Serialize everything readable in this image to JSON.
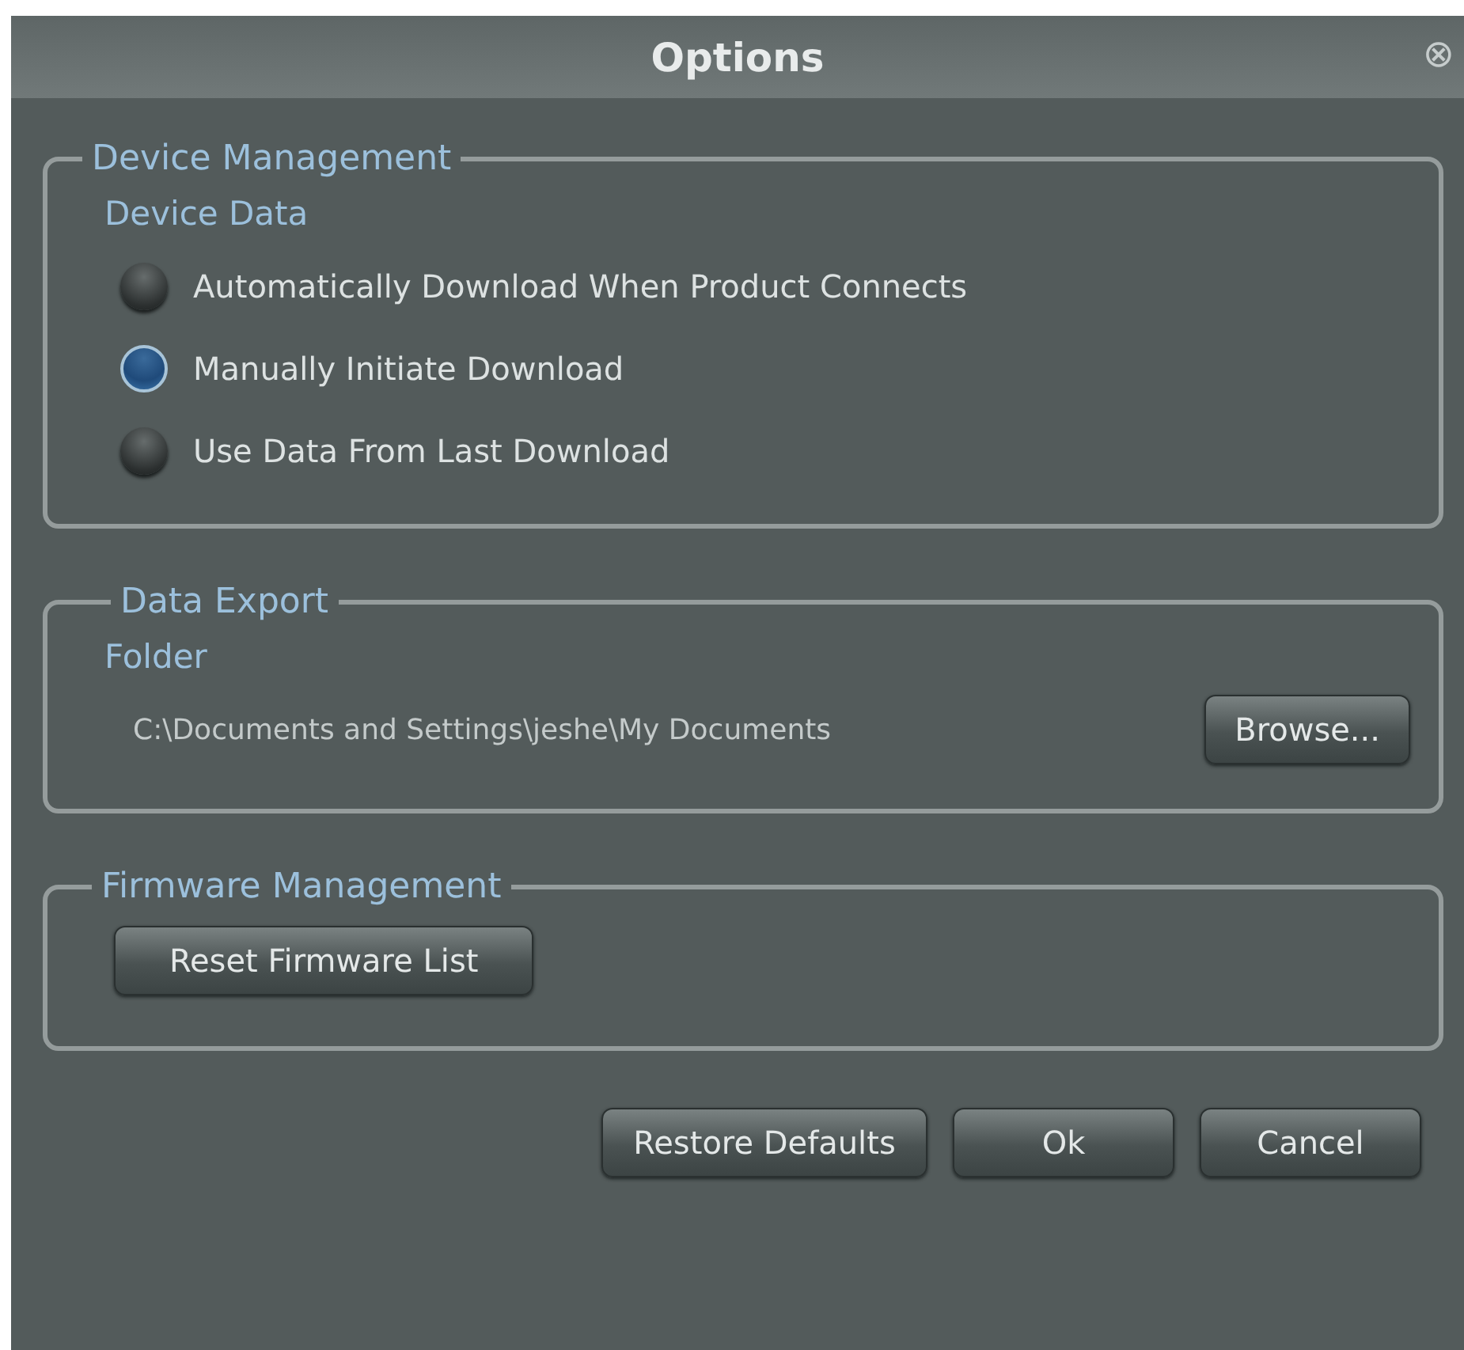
{
  "window": {
    "title": "Options",
    "close_icon": "⊗"
  },
  "sections": [
    {
      "kind": "radios",
      "title": "Device Management",
      "subtitle": "Device Data",
      "options": [
        {
          "label": "Automatically Download When Product Connects",
          "selected": false
        },
        {
          "label": "Manually Initiate Download",
          "selected": true
        },
        {
          "label": "Use Data From Last Download",
          "selected": false
        }
      ]
    },
    {
      "kind": "folder",
      "title": "Data Export",
      "subtitle": "Folder",
      "path": "C:\\Documents and Settings\\jeshe\\My Documents",
      "button": "Browse..."
    },
    {
      "kind": "button",
      "title": "Firmware Management",
      "button": "Reset Firmware List"
    }
  ],
  "buttons": [
    "Restore Defaults",
    "Ok",
    "Cancel"
  ]
}
